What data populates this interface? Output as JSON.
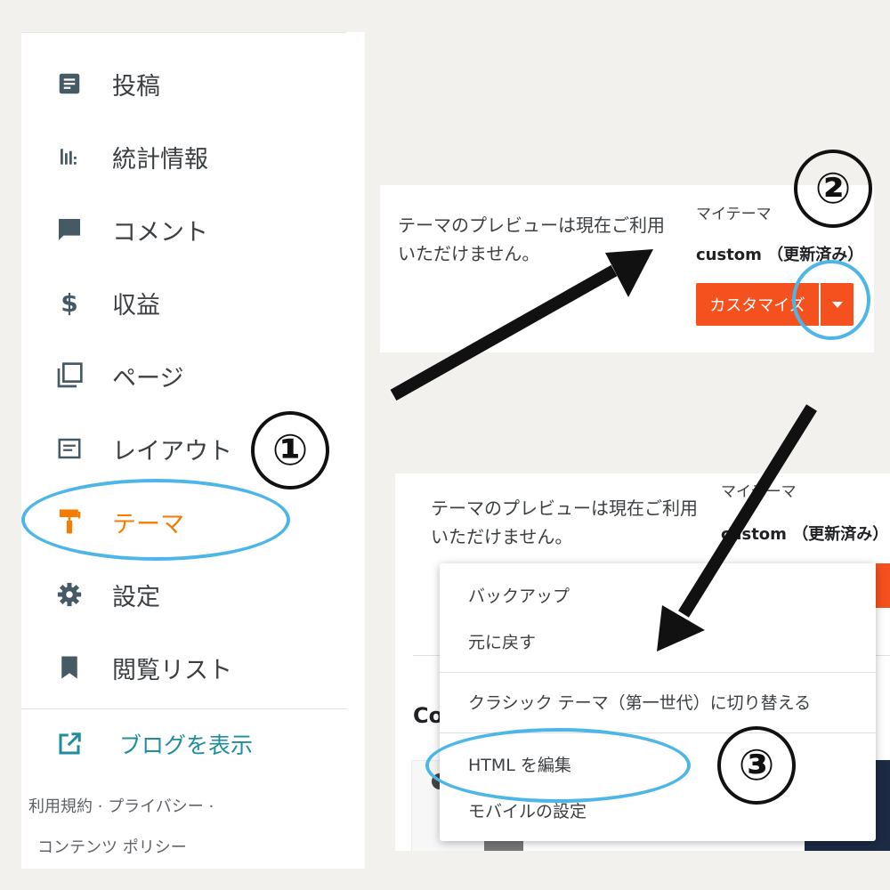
{
  "sidebar": {
    "items": [
      {
        "label": "投稿",
        "icon": "post-icon"
      },
      {
        "label": "統計情報",
        "icon": "stats-icon"
      },
      {
        "label": "コメント",
        "icon": "comment-icon"
      },
      {
        "label": "収益",
        "icon": "dollar-icon"
      },
      {
        "label": "ページ",
        "icon": "pages-icon"
      },
      {
        "label": "レイアウト",
        "icon": "layout-icon"
      },
      {
        "label": "テーマ",
        "icon": "paint-roller-icon"
      },
      {
        "label": "設定",
        "icon": "gear-icon"
      },
      {
        "label": "閲覧リスト",
        "icon": "bookmark-icon"
      }
    ],
    "active_item": "テーマ",
    "view_blog": "ブログを表示",
    "footer_line1": "利用規約 · プライバシー ·",
    "footer_line2": "コンテンツ ポリシー"
  },
  "annotations": {
    "step1": "①",
    "step2": "②",
    "step3": "③"
  },
  "theme_panel": {
    "preview_line1": "テーマのプレビューは現在ご利用",
    "preview_line2": "いただけません。",
    "my_theme_label": "マイテーマ",
    "theme_name": "custom （更新済み）",
    "customize_button": "カスタマイズ"
  },
  "theme_panel_2": {
    "preview_line1": "テーマのプレビューは現在ご利用",
    "preview_line2": "いただけません。",
    "my_theme_label": "マイテーマ",
    "theme_name": "custom （更新済み）",
    "partial_heading": "Co"
  },
  "dropdown_menu": {
    "items": [
      "バックアップ",
      "元に戻す",
      "クラシック テーマ（第一世代）に切り替える",
      "HTML を編集",
      "モバイルの設定"
    ]
  },
  "colors": {
    "accent_orange": "#f57c00",
    "button_orange": "#f4511e",
    "highlight_blue": "#4db6e8",
    "link_teal": "#1e8e9e"
  }
}
